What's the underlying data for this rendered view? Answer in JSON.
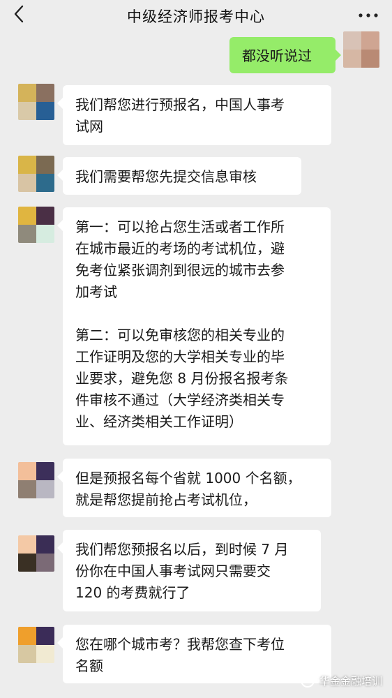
{
  "header": {
    "title": "中级经济师报考中心"
  },
  "messages": [
    {
      "side": "right",
      "text": "都没听说过"
    },
    {
      "side": "left",
      "text": "我们帮您进行预报名，中国人事考\n试网"
    },
    {
      "side": "left",
      "text": "我们需要帮您先提交信息审核"
    },
    {
      "side": "left",
      "text": "第一：可以抢占您生活或者工作所\n在城市最近的考场的考试机位，避\n免考位紧张调剂到很远的城市去参\n加考试\n\n第二：可以免审核您的相关专业的\n工作证明及您的大学相关专业的毕\n业要求，避免您 8 月份报名报考条\n件审核不通过（大学经济类相关专\n业、经济类相关工作证明）"
    },
    {
      "side": "left",
      "text": "但是预报名每个省就 1000 个名额，\n就是帮您提前抢占考试机位，"
    },
    {
      "side": "left",
      "text": "我们帮您预报名以后，到时候 7 月\n份你在中国人事考试网只需要交\n120 的考费就行了"
    },
    {
      "side": "left",
      "text": "您在哪个城市考？我帮您查下考位\n名额"
    }
  ],
  "watermark": {
    "text": "华金金融培训"
  },
  "colors": {
    "background": "#ededed",
    "bubble_incoming": "#ffffff",
    "bubble_outgoing": "#95ec69"
  },
  "icons": {
    "back": "chevron-left-icon",
    "more": "more-dots-icon",
    "watermark": "wechat-official-account-icon"
  }
}
